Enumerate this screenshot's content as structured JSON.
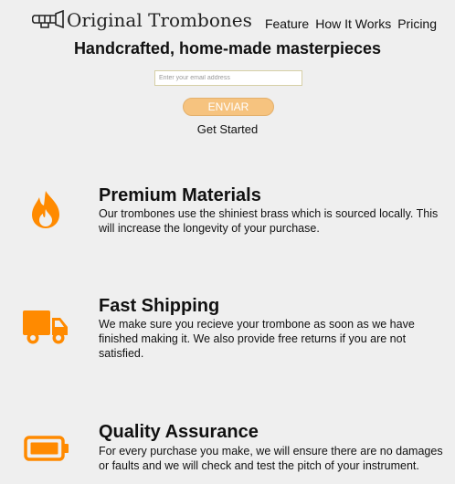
{
  "header": {
    "logo_text": "Original Trombones",
    "logo_icon": "trombone-icon",
    "nav": [
      {
        "label": "Feature"
      },
      {
        "label": "How It Works"
      },
      {
        "label": "Pricing"
      }
    ]
  },
  "hero": {
    "title": "Handcrafted, home-made masterpieces",
    "email_placeholder": "Enter your email address",
    "submit_label": "ENVIAR",
    "get_started": "Get Started"
  },
  "features": [
    {
      "icon": "fire-icon",
      "title": "Premium Materials",
      "text": "Our trombones use the shiniest brass which is sourced locally. This will increase the longevity of your purchase."
    },
    {
      "icon": "truck-icon",
      "title": "Fast Shipping",
      "text": "We make sure you recieve your trombone as soon as we have finished making it. We also provide free returns if you are not satisfied."
    },
    {
      "icon": "battery-icon",
      "title": "Quality Assurance",
      "text": "For every purchase you make, we will ensure there are no damages or faults and we will check and test the pitch of your instrument."
    }
  ],
  "colors": {
    "accent": "#ff8a00",
    "button_bg": "#f6c37f",
    "page_bg": "#efefef"
  }
}
